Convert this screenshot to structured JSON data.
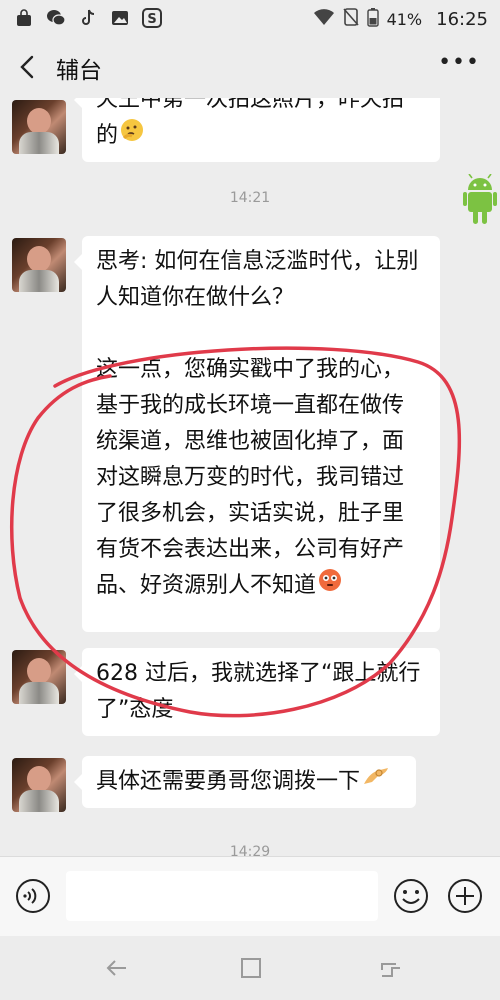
{
  "status_bar": {
    "battery": "41%",
    "time": "16:25",
    "left_icons": [
      "shopping-bag-icon",
      "wechat-icon",
      "tiktok-icon",
      "gallery-icon",
      "s-app-icon"
    ]
  },
  "header": {
    "title": "辅台",
    "more": "•••"
  },
  "messages": {
    "m0_line1": "天王中第一次拍这照片，昨天拍",
    "m0_line2": "的",
    "time1": "14:21",
    "m1_lines": [
      "思考: 如何在信息泛滥时代，让别",
      "人知道你在做什么？",
      "",
      "这一点，您确实戳中了我的心，",
      "基于我的成长环境一直都在做传",
      "统渠道，思维也被固化掉了，面",
      "对这瞬息万变的时代，我司错过",
      "了很多机会，实话实说，肚子里",
      "有货不会表达出来，公司有好产",
      "品、好资源别人不知道"
    ],
    "m2_line1": "628 过后，我就选择了“跟上就行",
    "m2_line2": "了”态度",
    "m3": "具体还需要勇哥您调拨一下",
    "time2": "14:29"
  },
  "colors": {
    "circle": "#e03a4a",
    "android": "#7cc242"
  }
}
